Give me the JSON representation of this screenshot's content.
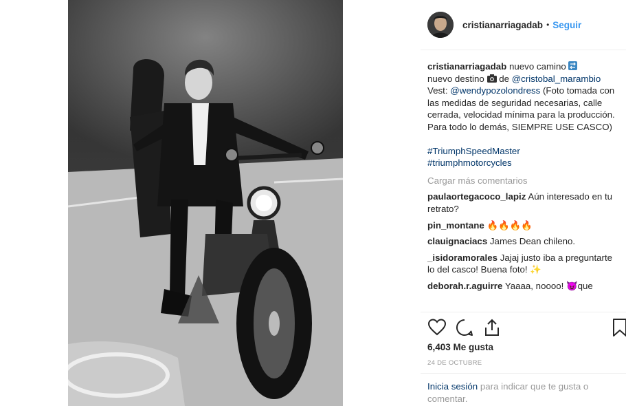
{
  "post": {
    "username": "cristianarriagadab",
    "separator": "•",
    "follow_label": "Seguir",
    "image_alt_icon": "photo-motorcycle-couple"
  },
  "caption": {
    "username": "cristianarriagadab",
    "line1": " nuevo camino ",
    "line2": "nuevo destino ",
    "line2b": " de ",
    "mention1": "@cristobal_marambio",
    "vest_label": "Vest: ",
    "mention2": "@wendypozolondress",
    "body": " (Foto tomada con las medidas de seguridad necesarias, calle cerrada, velocidad mínima para la producción. Para todo lo demás, SIEMPRE USE CASCO)",
    "hashtag1": "#TriumphSpeedMaster",
    "hashtag2": "#triumphmotorcycles",
    "icons": [
      "arrows-box-icon",
      "camera-icon"
    ]
  },
  "load_more": "Cargar más comentarios",
  "comments": [
    {
      "user": "paulaortegacoco_lapiz",
      "text": " Aún interesado en tu retrato?"
    },
    {
      "user": "pin_montane",
      "text": " 🔥🔥🔥🔥"
    },
    {
      "user": "clauignaciacs",
      "text": " James Dean chileno."
    },
    {
      "user": "_isidoramorales",
      "text": " Jajaj justo iba a preguntarte lo del casco! Buena foto! ✨"
    },
    {
      "user": "deborah.r.aguirre",
      "text": " Yaaaa, noooo! 😈que"
    }
  ],
  "likes": "6,403 Me gusta",
  "date": "24 DE OCTUBRE",
  "login": {
    "link": "Inicia sesión",
    "text": " para indicar que te gusta o comentar."
  },
  "colors": {
    "link": "#003569",
    "accent": "#3897f0",
    "muted": "#999999",
    "text": "#262626"
  }
}
